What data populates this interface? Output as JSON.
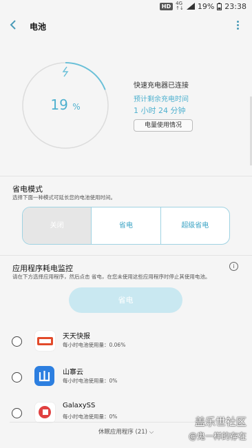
{
  "status_bar": {
    "hd": "HD",
    "net_top": "4G",
    "net_bottom": "↑↓",
    "battery": "19%",
    "time": "23:38"
  },
  "header": {
    "title": "电池"
  },
  "battery": {
    "level_percent": 19,
    "percent_value": "19",
    "percent_sign": "%",
    "charger_status": "快速充电器已连接",
    "remaining_label": "预计剩余充电时间",
    "remaining_time": "1 小时 24 分钟",
    "usage_button": "电量使用情况",
    "accent": "#4fb1cf"
  },
  "power_mode": {
    "title": "省电模式",
    "description": "选择下面一种模式可延长您的电池使用时间。",
    "modes": [
      "关闭",
      "省电",
      "超级省电"
    ]
  },
  "app_monitor": {
    "title": "应用程序耗电监控",
    "description": "请在下方选择应用程序，然后点击 省电，在您未使用这些应用程序时停止其使用电池。",
    "save_button": "省电",
    "apps": [
      {
        "name": "天天快报",
        "usage": "每小时电池使用量：0.06%",
        "icon": "kuaibao-icon"
      },
      {
        "name": "山寨云",
        "usage": "每小时电池使用量：0%",
        "icon": "shanzhaiyun-icon"
      },
      {
        "name": "GalaxySS",
        "usage": "每小时电池使用量：0%",
        "icon": "galaxyss-icon"
      }
    ],
    "sleeping_apps": "休眠应用程序 (21)"
  },
  "watermark": {
    "line1": "盖乐世社区",
    "line2": "@鬼一样的存在"
  }
}
